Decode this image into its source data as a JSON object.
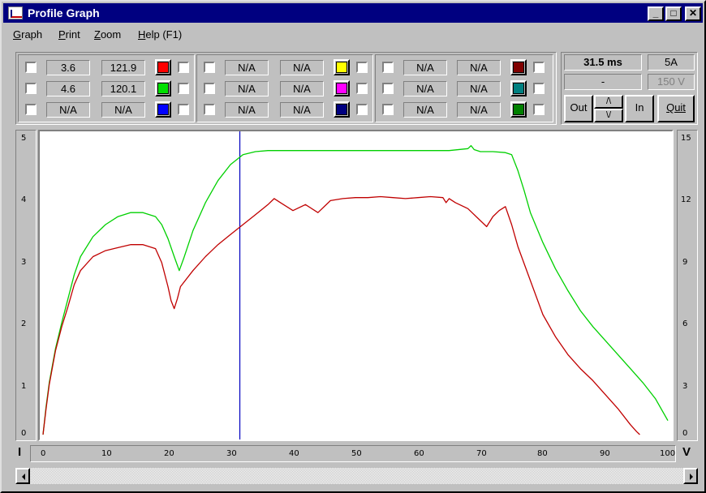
{
  "window": {
    "title": "Profile Graph",
    "controls": {
      "minimize": "_",
      "maximize": "□",
      "close": "✕"
    }
  },
  "menu": [
    {
      "key": "G",
      "rest": "raph"
    },
    {
      "key": "P",
      "rest": "rint"
    },
    {
      "key": "Z",
      "rest": "oom"
    },
    {
      "key": "H",
      "rest": "elp (F1)"
    }
  ],
  "channel_groups": [
    {
      "rows": [
        {
          "v1": "3.6",
          "v2": "121.9",
          "color": "#ff0000"
        },
        {
          "v1": "4.6",
          "v2": "120.1",
          "color": "#00e000"
        },
        {
          "v1": "N/A",
          "v2": "N/A",
          "color": "#0000ff"
        }
      ]
    },
    {
      "rows": [
        {
          "v1": "N/A",
          "v2": "N/A",
          "color": "#ffff00"
        },
        {
          "v1": "N/A",
          "v2": "N/A",
          "color": "#ff00ff"
        },
        {
          "v1": "N/A",
          "v2": "N/A",
          "color": "#000080"
        }
      ]
    },
    {
      "rows": [
        {
          "v1": "N/A",
          "v2": "N/A",
          "color": "#800000"
        },
        {
          "v1": "N/A",
          "v2": "N/A",
          "color": "#008080"
        },
        {
          "v1": "N/A",
          "v2": "N/A",
          "color": "#008000"
        }
      ]
    }
  ],
  "status": {
    "time": "31.5 ms",
    "current_range": "5A",
    "readout": "-",
    "voltage_range": "150 V"
  },
  "zoom_controls": {
    "out_label": "Out",
    "up_label": "/\\",
    "down_label": "\\/",
    "in_label": "In",
    "quit_label": "Quit"
  },
  "axes": {
    "left_letter": "I",
    "right_letter": "V",
    "left_ticks": [
      "5",
      "4",
      "3",
      "2",
      "1",
      "0"
    ],
    "right_ticks": [
      "15",
      "12",
      "9",
      "6",
      "3",
      "0"
    ],
    "x_ticks": [
      "0",
      "10",
      "20",
      "30",
      "40",
      "50",
      "60",
      "70",
      "80",
      "90",
      "100"
    ]
  },
  "chart_data": {
    "type": "line",
    "xlim": [
      0,
      100
    ],
    "ylim_left": [
      0,
      5
    ],
    "ylim_right": [
      0,
      15
    ],
    "cursor_x": 31.5,
    "series": [
      {
        "color": "#00d000",
        "axis": "right",
        "x": [
          0,
          0.5,
          1,
          2,
          3,
          4,
          5,
          6,
          8,
          10,
          12,
          14,
          16,
          18,
          19,
          20,
          21,
          21.8,
          22.5,
          24,
          26,
          28,
          30,
          32,
          34,
          36,
          38,
          40,
          45,
          50,
          55,
          60,
          65,
          68,
          68.5,
          69,
          70,
          72,
          74,
          75,
          76,
          77,
          78,
          80,
          82,
          84,
          86,
          88,
          90,
          92,
          94,
          96,
          98,
          100
        ],
        "y": [
          0,
          1.4,
          2.6,
          4.3,
          5.6,
          6.8,
          8.0,
          8.9,
          9.9,
          10.5,
          10.9,
          11.1,
          11.1,
          10.9,
          10.5,
          9.8,
          8.9,
          8.2,
          8.8,
          10.2,
          11.6,
          12.7,
          13.5,
          14.0,
          14.15,
          14.2,
          14.2,
          14.2,
          14.2,
          14.2,
          14.2,
          14.2,
          14.2,
          14.3,
          14.45,
          14.25,
          14.15,
          14.15,
          14.1,
          14.0,
          13.2,
          12.2,
          11.1,
          9.6,
          8.3,
          7.2,
          6.2,
          5.4,
          4.7,
          4.0,
          3.3,
          2.6,
          1.8,
          0.7
        ]
      },
      {
        "color": "#c00000",
        "axis": "right",
        "x": [
          0,
          0.5,
          1,
          2,
          3,
          4,
          5,
          6,
          8,
          10,
          12,
          14,
          16,
          18,
          19,
          20,
          20.5,
          21,
          21.5,
          22,
          24,
          26,
          28,
          30,
          32,
          34,
          36,
          37,
          38,
          40,
          42,
          44,
          46,
          48,
          50,
          52,
          54,
          56,
          58,
          60,
          62,
          64,
          64.5,
          65,
          66,
          68,
          70,
          71,
          72,
          73,
          74,
          75,
          76,
          78,
          80,
          82,
          84,
          86,
          88,
          90,
          92,
          94,
          95,
          95.5
        ],
        "y": [
          0,
          1.3,
          2.5,
          4.2,
          5.4,
          6.4,
          7.5,
          8.2,
          8.9,
          9.2,
          9.35,
          9.5,
          9.5,
          9.3,
          8.6,
          7.4,
          6.7,
          6.3,
          6.8,
          7.4,
          8.2,
          8.9,
          9.5,
          10.0,
          10.5,
          11.0,
          11.5,
          11.8,
          11.6,
          11.2,
          11.5,
          11.1,
          11.7,
          11.8,
          11.85,
          11.85,
          11.9,
          11.85,
          11.8,
          11.85,
          11.9,
          11.85,
          11.6,
          11.8,
          11.6,
          11.3,
          10.7,
          10.4,
          10.9,
          11.2,
          11.4,
          10.5,
          9.4,
          7.7,
          6.0,
          4.9,
          4.0,
          3.3,
          2.7,
          2.0,
          1.3,
          0.5,
          0.15,
          0
        ]
      }
    ]
  }
}
